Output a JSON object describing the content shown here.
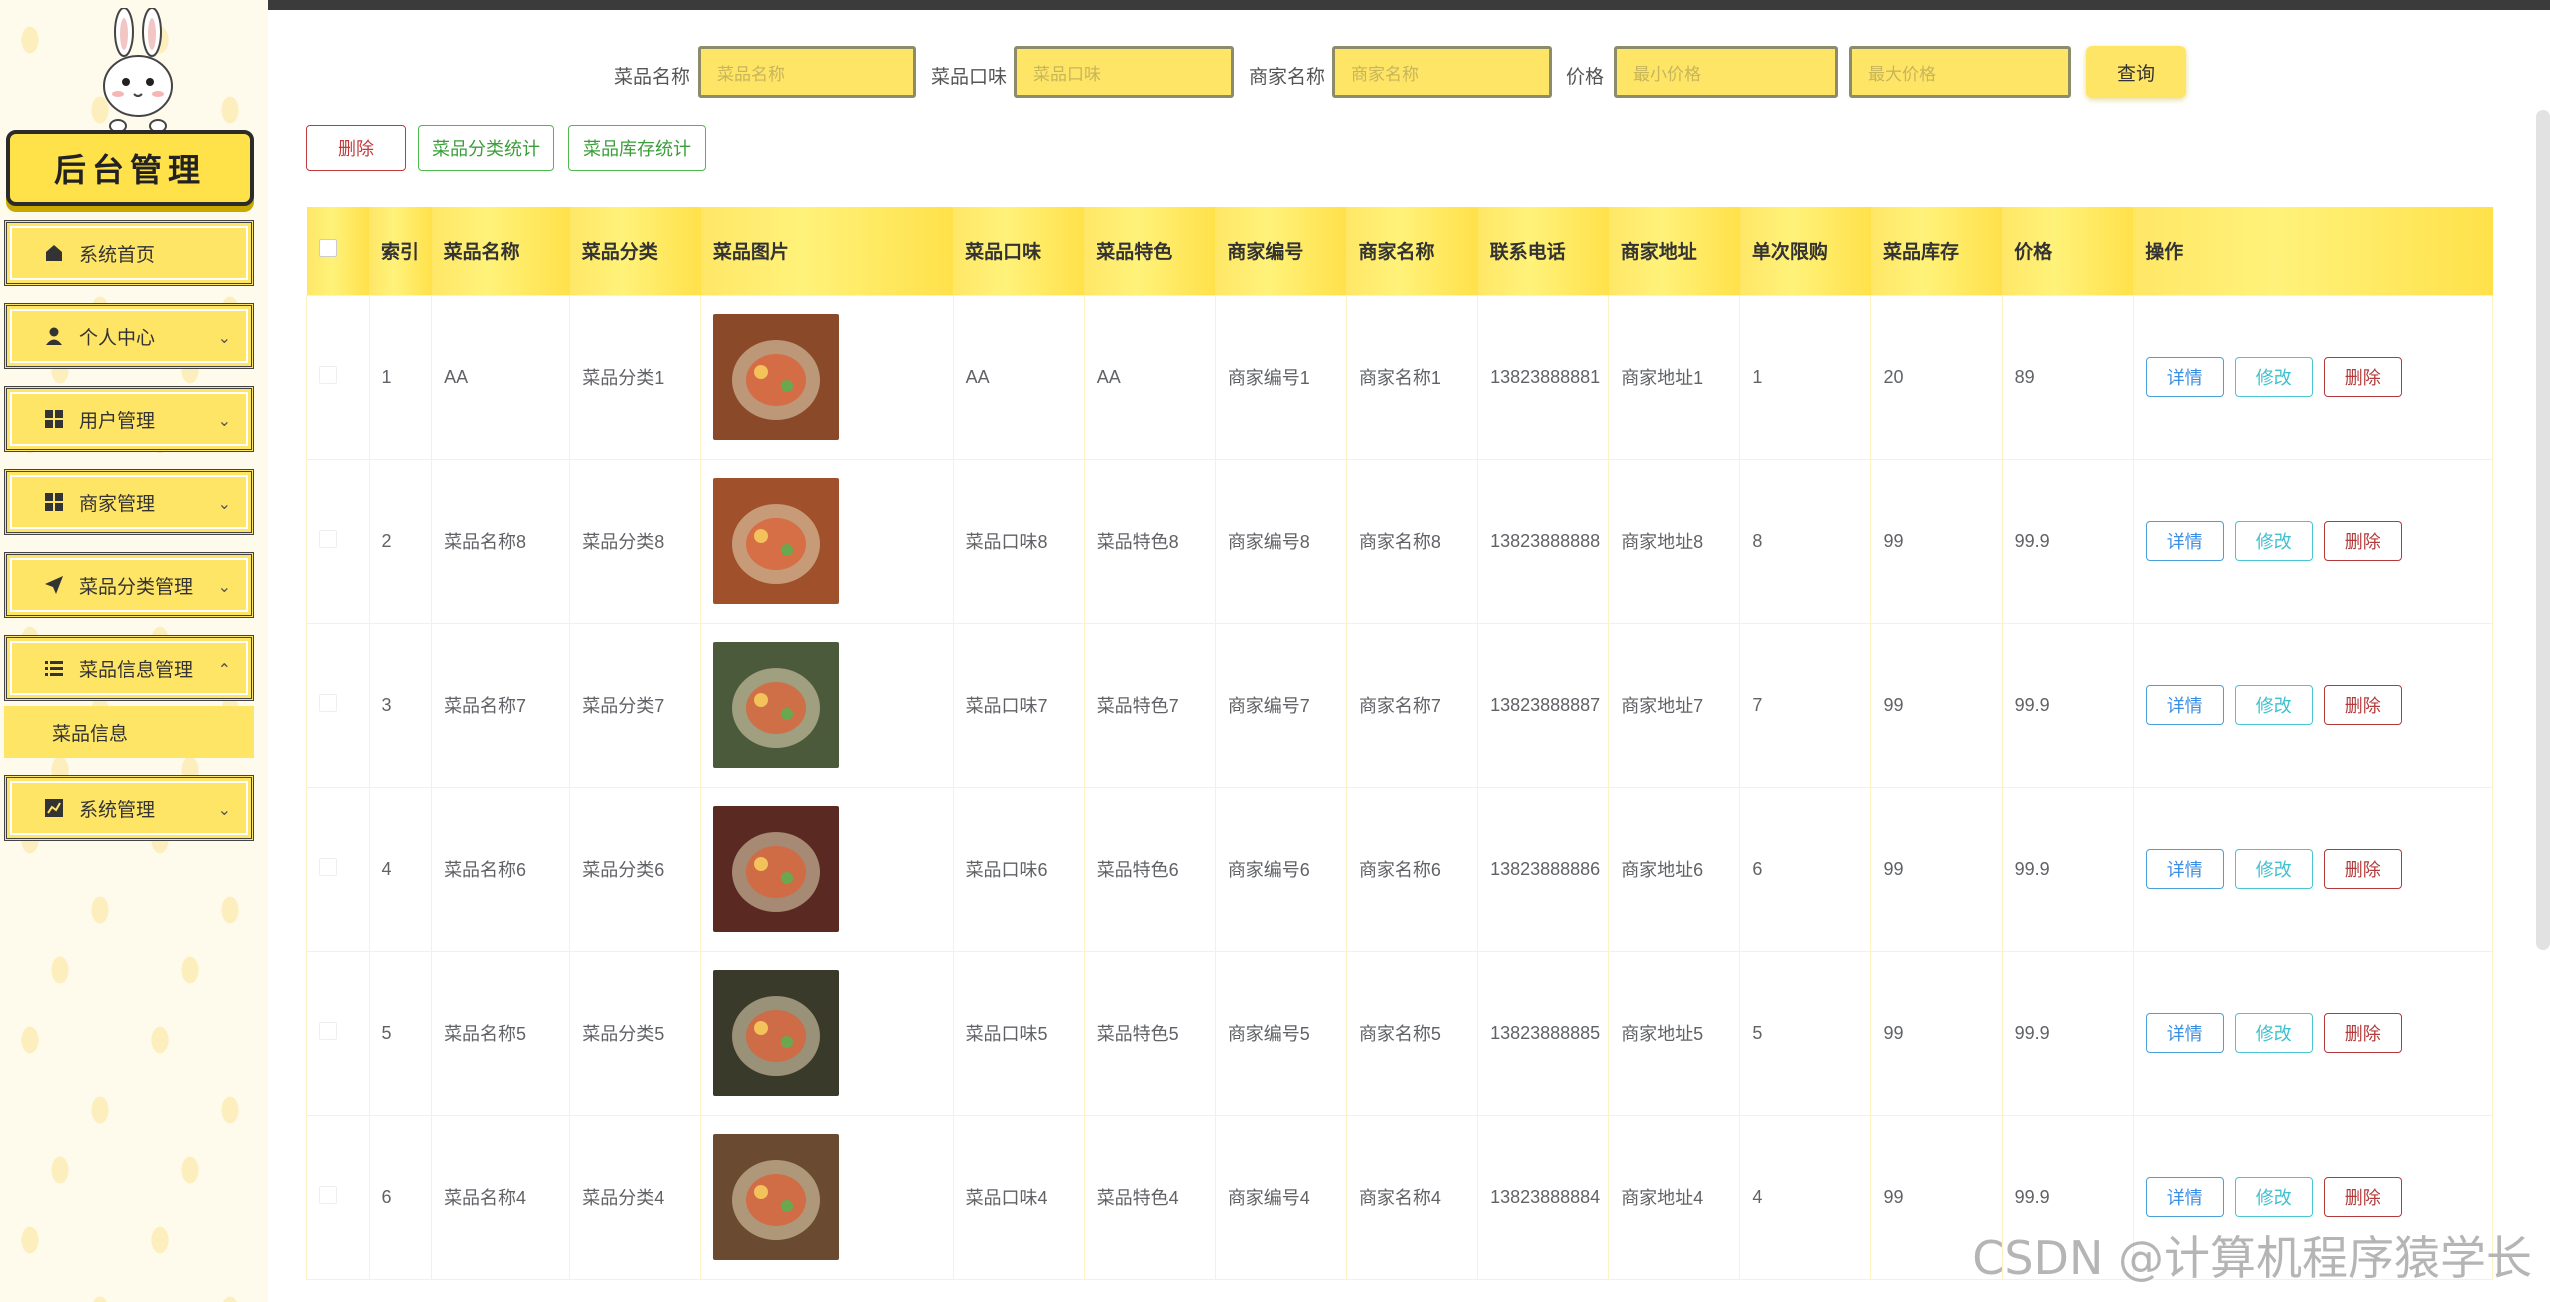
{
  "sidebar": {
    "logo_text": "后台管理",
    "items": [
      {
        "label": "系统首页",
        "icon": "home-icon",
        "chevron": ""
      },
      {
        "label": "个人中心",
        "icon": "user-icon",
        "chevron": "⌄"
      },
      {
        "label": "用户管理",
        "icon": "grid-icon",
        "chevron": "⌄"
      },
      {
        "label": "商家管理",
        "icon": "grid-icon",
        "chevron": "⌄"
      },
      {
        "label": "菜品分类管理",
        "icon": "send-icon",
        "chevron": "⌄"
      },
      {
        "label": "菜品信息管理",
        "icon": "list-icon",
        "chevron": "⌃"
      },
      {
        "label": "系统管理",
        "icon": "chart-icon",
        "chevron": "⌄"
      }
    ],
    "submenu": {
      "label": "菜品信息"
    }
  },
  "search": {
    "name_label": "菜品名称",
    "name_placeholder": "菜品名称",
    "taste_label": "菜品口味",
    "taste_placeholder": "菜品口味",
    "merchant_label": "商家名称",
    "merchant_placeholder": "商家名称",
    "price_label": "价格",
    "price_min_placeholder": "最小价格",
    "price_max_placeholder": "最大价格",
    "query_label": "查询"
  },
  "actions": {
    "delete_label": "删除",
    "category_stats_label": "菜品分类统计",
    "stock_stats_label": "菜品库存统计"
  },
  "table": {
    "headers": [
      "",
      "索引",
      "菜品名称",
      "菜品分类",
      "菜品图片",
      "菜品口味",
      "菜品特色",
      "商家编号",
      "商家名称",
      "联系电话",
      "商家地址",
      "单次限购",
      "菜品库存",
      "价格",
      "操作"
    ],
    "rows": [
      {
        "index": "1",
        "name": "AA",
        "category": "菜品分类1",
        "taste": "AA",
        "feature": "AA",
        "merchant_no": "商家编号1",
        "merchant_name": "商家名称1",
        "phone": "13823888881",
        "address": "商家地址1",
        "limit": "1",
        "stock": "20",
        "price": "89",
        "img_color": "#8a4a2a"
      },
      {
        "index": "2",
        "name": "菜品名称8",
        "category": "菜品分类8",
        "taste": "菜品口味8",
        "feature": "菜品特色8",
        "merchant_no": "商家编号8",
        "merchant_name": "商家名称8",
        "phone": "13823888888",
        "address": "商家地址8",
        "limit": "8",
        "stock": "99",
        "price": "99.9",
        "img_color": "#a0502a"
      },
      {
        "index": "3",
        "name": "菜品名称7",
        "category": "菜品分类7",
        "taste": "菜品口味7",
        "feature": "菜品特色7",
        "merchant_no": "商家编号7",
        "merchant_name": "商家名称7",
        "phone": "13823888887",
        "address": "商家地址7",
        "limit": "7",
        "stock": "99",
        "price": "99.9",
        "img_color": "#4a5a3a"
      },
      {
        "index": "4",
        "name": "菜品名称6",
        "category": "菜品分类6",
        "taste": "菜品口味6",
        "feature": "菜品特色6",
        "merchant_no": "商家编号6",
        "merchant_name": "商家名称6",
        "phone": "13823888886",
        "address": "商家地址6",
        "limit": "6",
        "stock": "99",
        "price": "99.9",
        "img_color": "#5a2a22"
      },
      {
        "index": "5",
        "name": "菜品名称5",
        "category": "菜品分类5",
        "taste": "菜品口味5",
        "feature": "菜品特色5",
        "merchant_no": "商家编号5",
        "merchant_name": "商家名称5",
        "phone": "13823888885",
        "address": "商家地址5",
        "limit": "5",
        "stock": "99",
        "price": "99.9",
        "img_color": "#3a3a2a"
      },
      {
        "index": "6",
        "name": "菜品名称4",
        "category": "菜品分类4",
        "taste": "菜品口味4",
        "feature": "菜品特色4",
        "merchant_no": "商家编号4",
        "merchant_name": "商家名称4",
        "phone": "13823888884",
        "address": "商家地址4",
        "limit": "4",
        "stock": "99",
        "price": "99.9",
        "img_color": "#6a4a30"
      }
    ],
    "row_actions": {
      "detail": "详情",
      "edit": "修改",
      "delete": "删除"
    }
  },
  "watermark": "CSDN @计算机程序猿学长"
}
